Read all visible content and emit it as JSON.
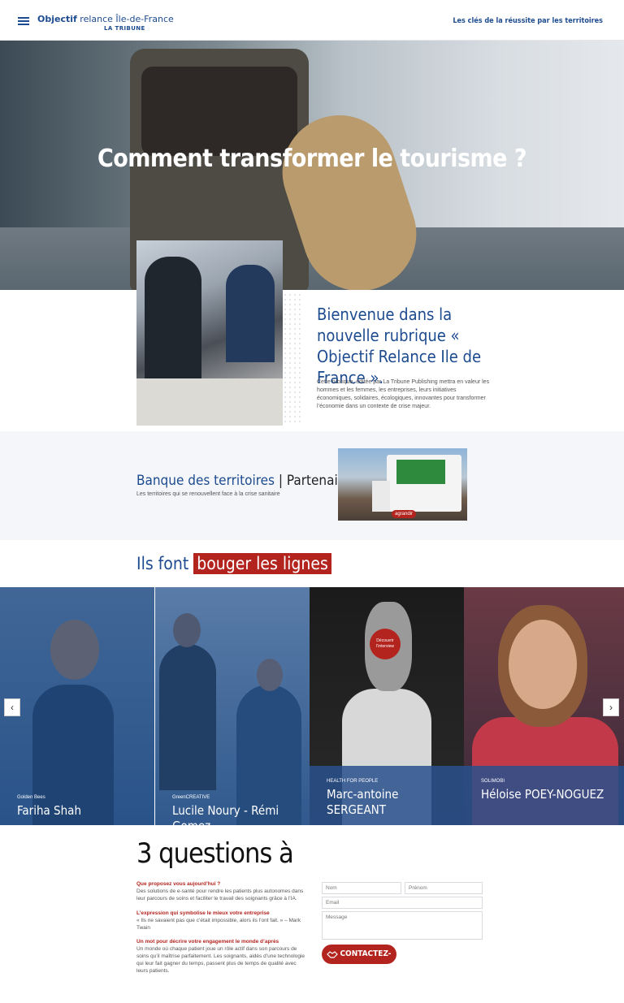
{
  "header": {
    "logo_bold": "Objectif",
    "logo_rest": " relance Île-de-France",
    "logo_sub": "LA TRIBUNE",
    "tagline": "Les clés de la réussite par les territoires"
  },
  "hero": {
    "title": "Comment transformer le tourisme ?"
  },
  "intro": {
    "title": "Bienvenue dans la nouvelle rubrique « Objectif Relance Ile de France ».",
    "text": "Cette rubrique, éditée par La Tribune Publishing mettra en valeur les hommes et les femmes, les entreprises, leurs initiatives économiques, solidaires, écologiques, innovantes pour transformer l’économie dans un contexte de crise majeur."
  },
  "partner": {
    "title": "Banque des territoires",
    "separator": "|",
    "tag": "Partenaire",
    "subtitle": "Les territoires qui se renouvellent face à la crise sanitaire",
    "enlarge": "agrandir"
  },
  "lines": {
    "prefix": "Ils font",
    "highlight": "bouger les lignes"
  },
  "carousel": {
    "discover": "Découvrir l’interview",
    "cards": [
      {
        "company": "Golden Bees",
        "name": "Fariha Shah"
      },
      {
        "company": "GreenCREATIVE",
        "name": "Lucile Noury - Rémi Gomez"
      },
      {
        "company": "HEALTH FOR PEOPLE",
        "name": "Marc-antoine SERGEANT"
      },
      {
        "company": "SOLIMOBI",
        "name": "Héloise POEY-NOGUEZ"
      }
    ]
  },
  "questions": {
    "title": "3 questions à",
    "items": [
      {
        "q": "Que proposez vous aujourd’hui ?",
        "a": "Des solutions de e-santé pour rendre les patients plus autonomes dans leur parcours de soins et faciliter le travail des soignants grâce à l’IA."
      },
      {
        "q": "L’expression qui symbolise le mieux votre entreprise",
        "a": "« Ils ne savaient pas que c’était impossible, alors ils l’ont fait. » – Mark Twain"
      },
      {
        "q": "Un mot pour décrire votre engagement le monde d’après",
        "a": "Un monde où chaque patient joue un rôle actif dans son parcours de soins qu’il maîtrise parfaitement. Les soignants, aidés d’une technologie qui leur fait gagner du temps, passent plus de temps de qualité avec leurs patients."
      }
    ]
  },
  "form": {
    "nom": "Nom",
    "prenom": "Prénom",
    "email": "Email",
    "message": "Message",
    "button": "CONTACTEZ-MOI"
  }
}
